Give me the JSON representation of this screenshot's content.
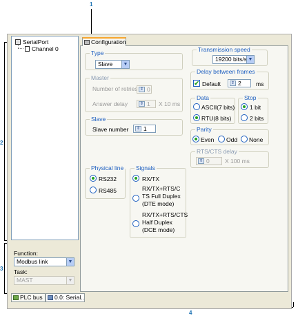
{
  "callouts": {
    "c1": "1",
    "c2": "2",
    "c3": "3",
    "c4": "4"
  },
  "tree": {
    "root": "SerialPort",
    "child": "Channel 0"
  },
  "config_tab": "Configuration",
  "type": {
    "label": "Type",
    "value": "Slave"
  },
  "master": {
    "label": "Master",
    "retries_label": "Number of retries",
    "retries_value": "0",
    "delay_label": "Answer delay",
    "delay_value": "1",
    "delay_unit": "X 10 ms"
  },
  "slave": {
    "label": "Slave",
    "number_label": "Slave number",
    "number_value": "1"
  },
  "physical_line": {
    "label": "Physical line",
    "options": [
      "RS232",
      "RS485"
    ],
    "selected": "RS232"
  },
  "signals": {
    "label": "Signals",
    "opt1": "RX/TX",
    "opt2_lines": [
      "RX/TX+RTS/C",
      "TS Full Duplex",
      "(DTE mode)"
    ],
    "opt3_lines": [
      "RX/TX+RTS/CTS",
      "Half Duplex",
      "(DCE mode)"
    ],
    "selected": "RX/TX"
  },
  "transmission": {
    "label": "Transmission speed",
    "value": "19200 bits/s"
  },
  "frames_delay": {
    "label": "Delay between frames",
    "default_label": "Default",
    "default_checked": true,
    "value": "2",
    "unit": "ms"
  },
  "data": {
    "label": "Data",
    "options": [
      "ASCII(7 bits)",
      "RTU(8 bits)"
    ],
    "selected": "RTU(8 bits)"
  },
  "stop": {
    "label": "Stop",
    "options": [
      "1 bit",
      "2 bits"
    ],
    "selected": "1 bit"
  },
  "parity": {
    "label": "Parity",
    "options": [
      "Even",
      "Odd",
      "None"
    ],
    "selected": "Even"
  },
  "rts_cts": {
    "label": "RTS/CTS delay",
    "value": "0",
    "unit": "X 100 ms"
  },
  "function": {
    "label": "Function:",
    "value": "Modbus link"
  },
  "task": {
    "label": "Task:",
    "value": "MAST"
  },
  "bottom_tabs": [
    "PLC bus",
    "0.0: Serial.."
  ],
  "colors": {
    "accent": "#1c5ec0",
    "callout": "#1f74b4",
    "radio_on": "#21a121",
    "tab_highlight": "#f7a52d"
  }
}
